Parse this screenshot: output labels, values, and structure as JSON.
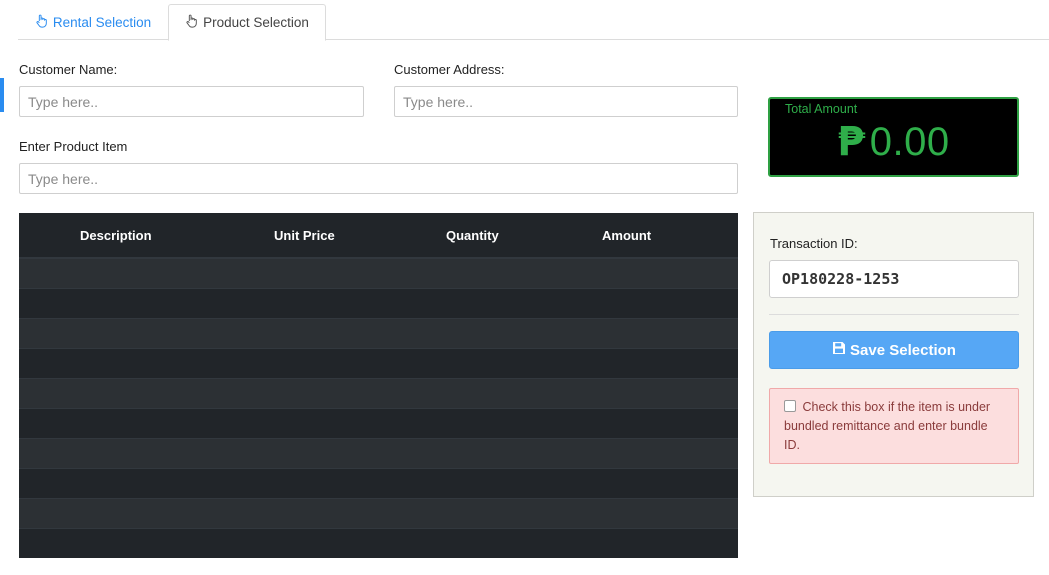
{
  "tabs": [
    {
      "label": "Rental Selection",
      "icon": "hand-pointer-icon",
      "active": false
    },
    {
      "label": "Product Selection",
      "icon": "hand-pointer-icon",
      "active": true
    }
  ],
  "form": {
    "customer_name_label": "Customer Name:",
    "customer_name_placeholder": "Type here..",
    "customer_address_label": "Customer Address:",
    "customer_address_placeholder": "Type here..",
    "product_item_label": "Enter Product Item",
    "product_item_placeholder": "Type here.."
  },
  "total": {
    "title": "Total Amount",
    "currency_symbol": "₱",
    "value": "0.00"
  },
  "table": {
    "columns": [
      "Description",
      "Unit Price",
      "Quantity",
      "Amount"
    ],
    "rows": []
  },
  "side": {
    "transaction_label": "Transaction ID:",
    "transaction_id": "OP180228-1253",
    "save_label": "Save Selection",
    "bundle_note": "Check this box if the item is under bundled remittance and enter bundle ID."
  },
  "colors": {
    "accent": "#2a8cf0",
    "total_green": "#2fae4a",
    "save_button": "#56a7f5",
    "alert_bg": "#fcdede"
  }
}
